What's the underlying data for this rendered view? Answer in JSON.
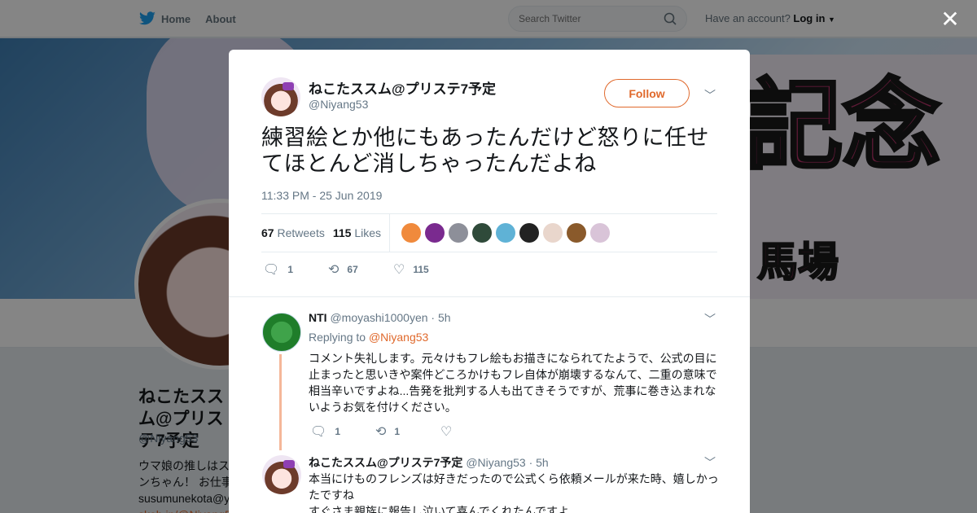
{
  "nav": {
    "home": "Home",
    "about": "About",
    "search_placeholder": "Search Twitter",
    "account_prefix": "Have an account?",
    "login": "Log in"
  },
  "background": {
    "banner_text": "記念",
    "banner_text2": "馬場",
    "name": "ねこたススム@プリステ7予定",
    "handle": "@Niyang53",
    "bio_line1": "ウマ娘の推しはス",
    "bio_line2": "ンちゃん！ お仕事",
    "bio_line3": "susumunekota@y",
    "bio_link": "skeb.jp/@Niyang53"
  },
  "tweet": {
    "name": "ねこたススム@プリステ7予定",
    "handle": "@Niyang53",
    "follow_label": "Follow",
    "text": "練習絵とか他にもあったんだけど怒りに任せてほとんど消しちゃったんだよね",
    "time": "11:33 PM - 25 Jun 2019",
    "retweets_count": "67",
    "retweets_label": "Retweets",
    "likes_count": "115",
    "likes_label": "Likes",
    "liker_colors": [
      "#f08a3c",
      "#7a2a8f",
      "#8d8f99",
      "#2f4a3a",
      "#5fb2d6",
      "#222222",
      "#e9d6cc",
      "#8a5a2b",
      "#d9c4d8"
    ],
    "reply_count": "1",
    "retweet_count_action": "67",
    "like_count_action": "115"
  },
  "reply1": {
    "name": "NTI",
    "handle": "@moyashi1000yen",
    "time": "· 5h",
    "replying_prefix": "Replying to",
    "replying_to": "@Niyang53",
    "text": "コメント失礼します。元々けもフレ絵もお描きになられてたようで、公式の目に止まったと思いきや案件どころかけもフレ自体が崩壊するなんて、二重の意味で相当辛いですよね...告発を批判する人も出てきそうですが、荒事に巻き込まれないようお気を付けください。",
    "reply_count": "1",
    "retweet_count": "1"
  },
  "reply2": {
    "name": "ねこたススム@プリステ7予定",
    "handle": "@Niyang53",
    "time": "· 5h",
    "text_line1": "本当にけものフレンズは好きだったので公式くら依頼メールが来た時、嬉しかったですね",
    "text_line2": "すぐさま親族に報告し泣いて喜んでくれたんですよ"
  }
}
